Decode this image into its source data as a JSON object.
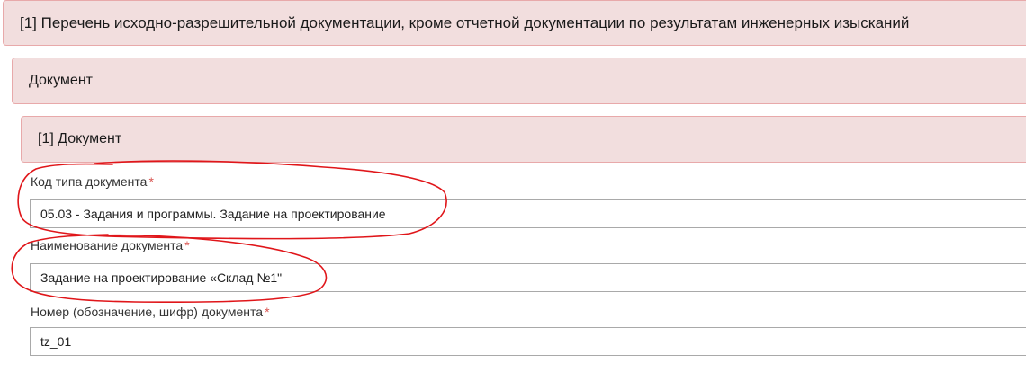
{
  "section": {
    "title": "[1] Перечень исходно-разрешительной документации, кроме отчетной документации по результатам инженерных изысканий"
  },
  "group": {
    "title": "Документ"
  },
  "item": {
    "title": "[1] Документ"
  },
  "fields": {
    "doc_type_code": {
      "label": "Код типа документа",
      "required_mark": "*",
      "value": "05.03 - Задания и программы. Задание на проектирование"
    },
    "doc_name": {
      "label": "Наименование документа",
      "required_mark": "*",
      "value": "Задание на проектирование «Склад №1\""
    },
    "doc_number": {
      "label": "Номер (обозначение, шифр) документа",
      "required_mark": "*",
      "value": "tz_01"
    }
  },
  "colors": {
    "panel_header_bg": "#f2dede",
    "panel_header_border": "#e8a9aa",
    "required_mark": "#d9534f",
    "annotation_ink": "#e0161a"
  }
}
